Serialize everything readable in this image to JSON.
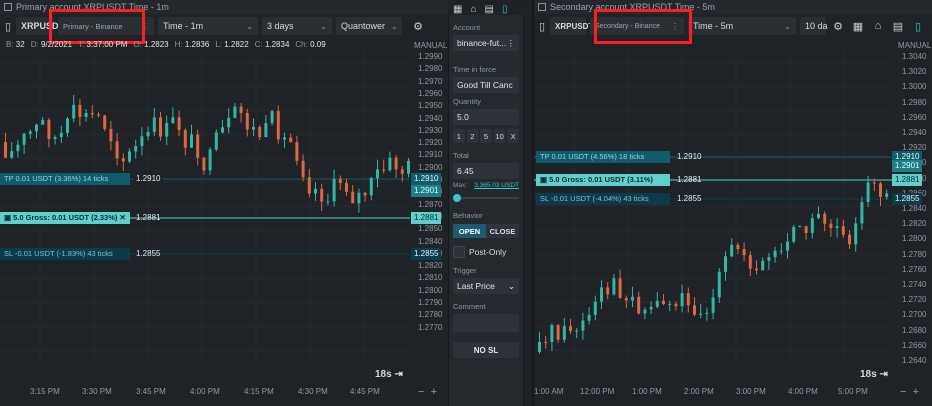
{
  "colors": {
    "up": "#2fb8a6",
    "down": "#e0673e",
    "accent": "#39c5cf",
    "tp": "#0f5c6b",
    "sl": "#0d3b4a",
    "mid": "#5fd0c9",
    "highlight": "#ff1d1d"
  },
  "left": {
    "window_title": "Primary account XRPUSDT Time - 1m",
    "symbol": "XRPUSDT",
    "account": "Primary - Binance",
    "timeframe": "Time - 1m",
    "range": "3 days",
    "style": "Quantower",
    "ohlc": {
      "b_label": "B:",
      "b_val": "32",
      "d_label": "D:",
      "d_val": "9/2/2021",
      "t_label": "T:",
      "t_val": "3:37:00 PM",
      "o_label": "O:",
      "o_val": "1.2823",
      "h_label": "H:",
      "h_val": "1.2836",
      "l_label": "L:",
      "l_val": "1.2822",
      "c_label": "C:",
      "c_val": "1.2834",
      "ch_label": "Ch:",
      "ch_val": "0.09"
    },
    "axis_mode": "MANUAL",
    "price_ticks": [
      "1.2990",
      "1.2980",
      "1.2970",
      "1.2960",
      "1.2950",
      "1.2940",
      "1.2930",
      "1.2920",
      "1.2910",
      "1.2900",
      "1.2890",
      "1.2880",
      "1.2870",
      "1.2860",
      "1.2850",
      "1.2840",
      "1.2830",
      "1.2820",
      "1.2810",
      "1.2800",
      "1.2790",
      "1.2780",
      "1.2770"
    ],
    "time_ticks": [
      "3:15 PM",
      "3:30 PM",
      "3:45 PM",
      "4:00 PM",
      "4:15 PM",
      "4:30 PM",
      "4:45 PM"
    ],
    "tp_text": "TP 0.01 USDT (3.36%) 14 ticks",
    "tp_price": "1.2910",
    "mid_text": "5.0 Gross: 0.01 USDT (2.33%)",
    "mid_price": "1.2881",
    "sl_text": "SL -0.01 USDT (-1.83%) 43 ticks",
    "sl_price": "1.2855",
    "tag_tp": "1.2910",
    "tag_cur": "1.2901",
    "tag_mid": "1.2881",
    "tag_sl": "1.2855",
    "timer": "18s"
  },
  "side": {
    "account_label": "Account",
    "account_value": "binance-fut...",
    "tif_label": "Time in force",
    "tif_value": "Good Till Canc",
    "qty_label": "Quantity",
    "qty_value": "5.0",
    "qty_buttons": [
      "1",
      "2",
      "5",
      "10",
      "X"
    ],
    "total_label": "Total",
    "total_value": "6.45",
    "max_label": "Max:",
    "max_value": "3,365.03 USDT",
    "behavior_label": "Behavior",
    "open_label": "OPEN",
    "close_label": "CLOSE",
    "postonly_label": "Post-Only",
    "trigger_label": "Trigger",
    "trigger_value": "Last Price",
    "comment_label": "Comment",
    "nosl_label": "NO SL"
  },
  "right": {
    "window_title": "Secondary account XRPUSDT Time - 5m",
    "symbol": "XRPUSDT",
    "account": "Secondary - Binance",
    "timeframe": "Time - 5m",
    "range": "10 da",
    "axis_mode": "MANUAL",
    "price_ticks": [
      "1.3040",
      "1.3020",
      "1.3000",
      "1.2980",
      "1.2960",
      "1.2940",
      "1.2920",
      "1.2900",
      "1.2880",
      "1.2860",
      "1.2840",
      "1.2820",
      "1.2800",
      "1.2780",
      "1.2760",
      "1.2740",
      "1.2720",
      "1.2700",
      "1.2680",
      "1.2660",
      "1.2640"
    ],
    "time_ticks": [
      "1:00 AM",
      "12:00 PM",
      "1:00 PM",
      "2:00 PM",
      "3:00 PM",
      "4:00 PM",
      "5:00 PM"
    ],
    "tp_text": "TP 0.01 USDT (4.56%) 18 ticks",
    "tp_price": "1.2910",
    "mid_text": "5.0 Gross: 0.01 USDT (3.11%)",
    "mid_price": "1.2881",
    "sl_text": "SL -0.01 USDT (-4.04%) 43 ticks",
    "sl_price": "1.2855",
    "tag_tp": "1.2910",
    "tag_cur": "1.2901",
    "tag_mid": "1.2881",
    "tag_sl": "1.2855",
    "timer": "18s"
  }
}
